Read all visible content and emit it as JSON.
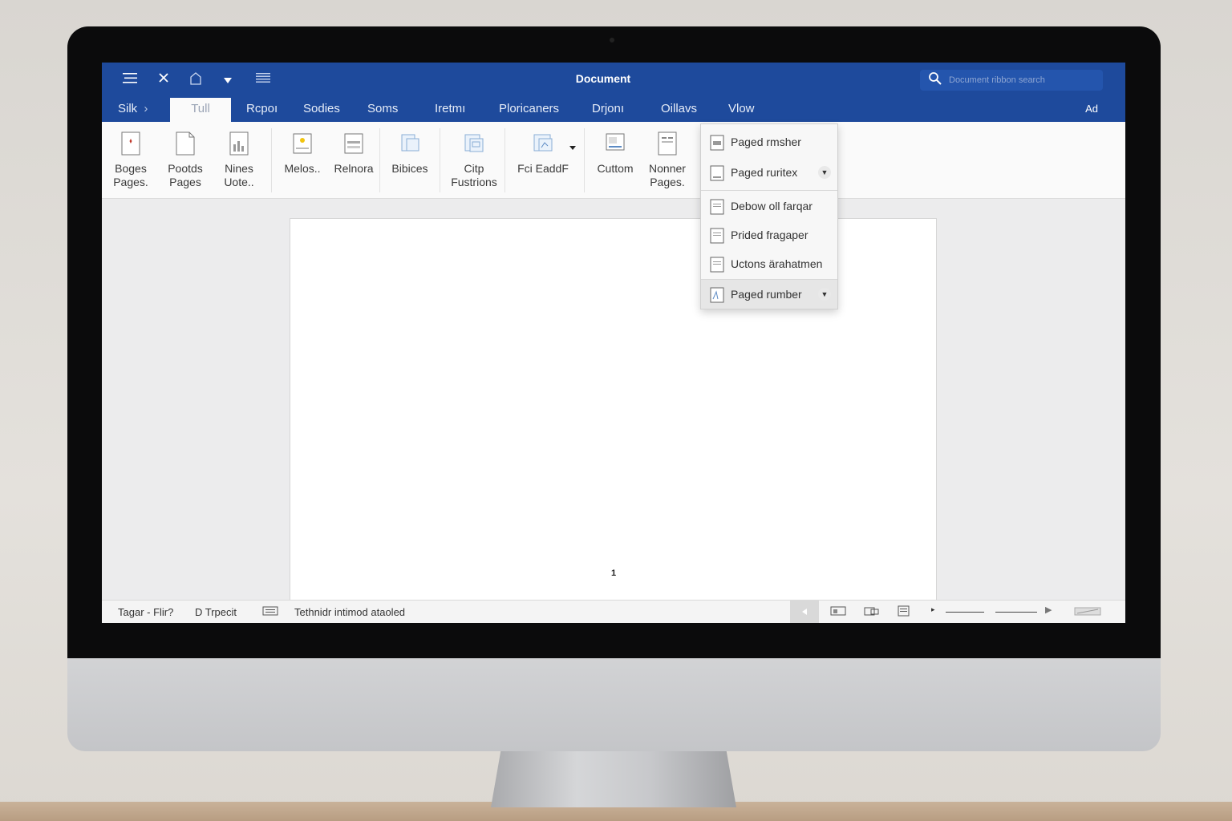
{
  "window": {
    "title": "Document",
    "search_placeholder": "Document ribbon search"
  },
  "titlebar_icons": [
    "menu-icon",
    "close-icon",
    "home-icon",
    "dropdown-arrow-icon",
    "list-icon"
  ],
  "tabs": {
    "breadcrumb": "Silk",
    "items": [
      {
        "label": "Tull",
        "active": true
      },
      {
        "label": "Rcpoı"
      },
      {
        "label": "Sodies"
      },
      {
        "label": "Soms"
      },
      {
        "label": "Iretmı"
      },
      {
        "label": "Ploricaners"
      },
      {
        "label": "Drjonı"
      },
      {
        "label": "Oillavs"
      },
      {
        "label": "Vlow"
      }
    ],
    "right_label": "Ad"
  },
  "ribbon": {
    "buttons": [
      {
        "line1": "Boges",
        "line2": "Pages."
      },
      {
        "line1": "Pootds",
        "line2": "Pages"
      },
      {
        "line1": "Nines",
        "line2": "Uote.."
      },
      {
        "line1": "Melos..",
        "line2": ""
      },
      {
        "line1": "Relnora",
        "line2": ""
      },
      {
        "line1": "Bibices",
        "line2": ""
      },
      {
        "line1": "Citp",
        "line2": "Fustrions"
      },
      {
        "line1": "Fci EaddF",
        "line2": ""
      },
      {
        "line1": "Cuttom",
        "line2": ""
      },
      {
        "line1": "Nonner",
        "line2": "Pages."
      }
    ]
  },
  "dropdown": {
    "items": [
      {
        "label": "Paged rmsher",
        "chevron": false
      },
      {
        "label": "Paged ruritex",
        "chevron": true
      },
      {
        "label": "Debow oll farqar",
        "chevron": false
      },
      {
        "label": "Prided fragaper",
        "chevron": false
      },
      {
        "label": "Uctons ärahatmen",
        "chevron": false
      },
      {
        "label": "Paged rumber",
        "chevron": true
      }
    ]
  },
  "document": {
    "page_number": "1"
  },
  "statusbar": {
    "page_info": "Tagar - Flir?",
    "words": "D  Trpecit",
    "status_text": "Tethnidr intimod ataoled"
  },
  "colors": {
    "titlebar": "#1e4a9c",
    "ribbon": "#fafafa",
    "workspace": "#ececed"
  }
}
